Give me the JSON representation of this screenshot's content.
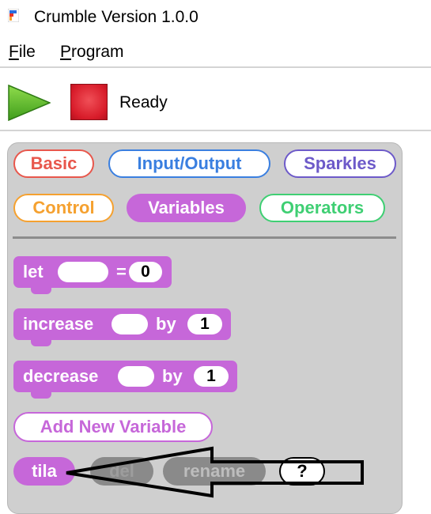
{
  "window": {
    "title": "Crumble Version 1.0.0"
  },
  "menu": {
    "file_label": "File",
    "file_mnemonic": "F",
    "file_rest": "ile",
    "program_label": "Program",
    "program_mnemonic": "P",
    "program_rest": "rogram"
  },
  "toolbar": {
    "play_icon": "play-icon",
    "stop_icon": "stop-icon",
    "status": "Ready"
  },
  "categories": [
    {
      "label": "Basic",
      "color": "#e8574c",
      "active": false
    },
    {
      "label": "Input/Output",
      "color": "#3a7fe0",
      "active": false
    },
    {
      "label": "Sparkles",
      "color": "#6d5ac9",
      "active": false
    },
    {
      "label": "Control",
      "color": "#f5a130",
      "active": false
    },
    {
      "label": "Variables",
      "color": "#c667d9",
      "active": true
    },
    {
      "label": "Operators",
      "color": "#3fcf73",
      "active": false
    }
  ],
  "blocks": {
    "let": {
      "keyword": "let",
      "equals": "=",
      "value": "0"
    },
    "increase": {
      "keyword": "increase",
      "by": "by",
      "value": "1"
    },
    "decrease": {
      "keyword": "decrease",
      "by": "by",
      "value": "1"
    }
  },
  "add_variable_label": "Add New Variable",
  "variable_actions": {
    "variable_name": "tila",
    "delete_label": "del",
    "rename_label": "rename",
    "help_label": "?"
  },
  "colors": {
    "variables_accent": "#c667d9",
    "stop_red": "#d81c2a",
    "play_green": "#5bbf2e"
  }
}
